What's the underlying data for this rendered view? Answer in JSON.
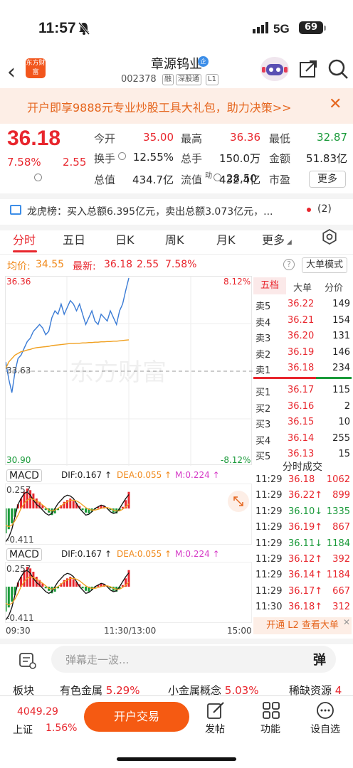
{
  "status_bar": {
    "time": "11:57",
    "network": "5G",
    "battery": "69"
  },
  "header": {
    "logo_text": "东方财富",
    "stock_name": "章源钨业",
    "badge": "企",
    "stock_code": "002378",
    "tags": [
      "融",
      "深股通",
      "L1"
    ]
  },
  "banner": {
    "text": "开户即享9888元专业炒股工具大礼包，助力决策>>"
  },
  "quote": {
    "price": "36.18",
    "change_pct": "7.58%",
    "change": "2.55",
    "rows": [
      [
        {
          "label": "今开",
          "value": "35.00",
          "color": "red"
        },
        {
          "label": "最高",
          "value": "36.36",
          "color": "red"
        },
        {
          "label": "最低",
          "value": "32.87",
          "color": "green"
        }
      ],
      [
        {
          "label": "换手",
          "value": "12.55%",
          "color": "black"
        },
        {
          "label": "总手",
          "value": "150.0万",
          "color": "black"
        },
        {
          "label": "金额",
          "value": "51.83亿",
          "color": "black"
        }
      ],
      [
        {
          "label": "总值",
          "value": "434.7亿",
          "color": "black"
        },
        {
          "label": "流值",
          "value": "432.4亿",
          "color": "black"
        },
        {
          "label": "市盈",
          "value": "28.50",
          "color": "black"
        }
      ]
    ],
    "pe_sup": "动",
    "more_label": "更多"
  },
  "longhu": {
    "text": "龙虎榜：买入总额6.395亿元，卖出总额3.073亿元，...",
    "count": "(2)"
  },
  "tabs": [
    "分时",
    "五日",
    "日K",
    "周K",
    "月K",
    "更多"
  ],
  "chart_header": {
    "avg_label": "均价:",
    "avg_value": "34.55",
    "latest_label": "最新:",
    "latest_value": "36.18",
    "latest_change": "2.55",
    "latest_pct": "7.58%",
    "help": "?",
    "big_order_mode": "大单模式"
  },
  "chart_data": {
    "type": "line",
    "x_labels": [
      "09:30",
      "11:30/13:00",
      "15:00"
    ],
    "ylim": [
      30.9,
      36.36
    ],
    "y_left_ticks": [
      "36.36",
      "33.63",
      "30.90"
    ],
    "y_right_ticks": [
      "8.12%",
      "-8.12%"
    ],
    "prev_close": 33.63,
    "watermark": "东方财富",
    "series": [
      {
        "values": [
          33.9,
          33.4,
          33.0,
          33.6,
          34.0,
          34.1,
          34.3,
          34.5,
          34.6,
          34.8,
          34.9,
          35.0,
          34.9,
          34.7,
          34.8,
          35.2,
          35.4,
          35.3,
          35.6,
          35.3,
          35.5,
          35.7,
          35.6,
          35.4,
          35.6,
          35.3,
          35.0,
          35.2,
          35.4,
          35.1,
          35.0,
          35.3,
          35.2,
          35.1,
          35.4,
          35.2,
          35.0,
          35.4,
          35.6,
          36.0,
          36.36
        ]
      },
      {
        "values": [
          33.7,
          33.9,
          34.0,
          34.1,
          34.15,
          34.2,
          34.22,
          34.25,
          34.27,
          34.3,
          34.32,
          34.33,
          34.34,
          34.35,
          34.36,
          34.38,
          34.39,
          34.4,
          34.41,
          34.42,
          34.43,
          34.44,
          34.44,
          34.45,
          34.45,
          34.46,
          34.46,
          34.47,
          34.47,
          34.48,
          34.48,
          34.49,
          34.49,
          34.5,
          34.5,
          34.51,
          34.51,
          34.52,
          34.53,
          34.54,
          34.55
        ]
      }
    ]
  },
  "orderbook": {
    "tabs": [
      "五档",
      "大单",
      "分价"
    ],
    "asks": [
      {
        "label": "卖5",
        "price": "36.22",
        "vol": "149"
      },
      {
        "label": "卖4",
        "price": "36.21",
        "vol": "154"
      },
      {
        "label": "卖3",
        "price": "36.20",
        "vol": "131"
      },
      {
        "label": "卖2",
        "price": "36.19",
        "vol": "146"
      },
      {
        "label": "卖1",
        "price": "36.18",
        "vol": "234"
      }
    ],
    "bids": [
      {
        "label": "买1",
        "price": "36.17",
        "vol": "115"
      },
      {
        "label": "买2",
        "price": "36.16",
        "vol": "2"
      },
      {
        "label": "买3",
        "price": "36.15",
        "vol": "10"
      },
      {
        "label": "买4",
        "price": "36.14",
        "vol": "255"
      },
      {
        "label": "买5",
        "price": "36.13",
        "vol": "15"
      }
    ]
  },
  "ticks": {
    "title": "分时成交",
    "rows": [
      {
        "time": "11:29",
        "price": "36.18",
        "arrow": "",
        "vol": "1062",
        "dir": "up"
      },
      {
        "time": "11:29",
        "price": "36.22",
        "arrow": "↑",
        "vol": "899",
        "dir": "up"
      },
      {
        "time": "11:29",
        "price": "36.10",
        "arrow": "↓",
        "vol": "1335",
        "dir": "down"
      },
      {
        "time": "11:29",
        "price": "36.19",
        "arrow": "↑",
        "vol": "867",
        "dir": "up"
      },
      {
        "time": "11:29",
        "price": "36.11",
        "arrow": "↓",
        "vol": "1184",
        "dir": "down"
      },
      {
        "time": "11:29",
        "price": "36.12",
        "arrow": "↑",
        "vol": "392",
        "dir": "up"
      },
      {
        "time": "11:29",
        "price": "36.14",
        "arrow": "↑",
        "vol": "1184",
        "dir": "up"
      },
      {
        "time": "11:29",
        "price": "36.17",
        "arrow": "↑",
        "vol": "667",
        "dir": "up"
      },
      {
        "time": "11:30",
        "price": "36.18",
        "arrow": "↑",
        "vol": "312",
        "dir": "up"
      }
    ],
    "l2_text": "开通 L2 查看大单"
  },
  "macd": {
    "label": "MACD",
    "dif": "DIF:0.167 ↑",
    "dea": "DEA:0.055 ↑",
    "m": "M:0.224 ↑",
    "top_tick": "0.257",
    "bottom_tick": "-0.411",
    "bars": [
      -0.3,
      -0.25,
      -0.18,
      -0.1,
      0.05,
      0.12,
      0.2,
      0.24,
      0.22,
      0.18,
      0.12,
      0.08,
      0.04,
      -0.02,
      -0.05,
      -0.08,
      -0.06,
      -0.02,
      0.04,
      0.08,
      0.1,
      0.12,
      0.09,
      0.06,
      0.03,
      -0.02,
      -0.05,
      -0.06,
      -0.04,
      -0.01,
      0.02,
      0.04,
      0.03,
      0.01,
      -0.02,
      -0.05,
      -0.06,
      -0.03,
      0.02,
      0.1,
      0.2
    ],
    "dif_line": [
      -0.4,
      -0.35,
      -0.25,
      -0.1,
      0.05,
      0.12,
      0.18,
      0.2,
      0.16,
      0.1,
      0.05,
      0.02,
      -0.02,
      -0.06,
      -0.08,
      -0.06,
      0.0,
      0.06,
      0.1,
      0.14,
      0.16,
      0.15,
      0.12,
      0.06,
      0.0,
      -0.04,
      -0.08,
      -0.07,
      -0.04,
      0.0,
      0.02,
      0.04,
      0.03,
      0.0,
      -0.04,
      -0.06,
      -0.05,
      0.0,
      0.06,
      0.12,
      0.167
    ],
    "dea_line": [
      -0.2,
      -0.22,
      -0.2,
      -0.15,
      -0.08,
      0.0,
      0.06,
      0.1,
      0.12,
      0.11,
      0.09,
      0.07,
      0.04,
      0.01,
      -0.02,
      -0.03,
      -0.02,
      0.0,
      0.03,
      0.06,
      0.08,
      0.1,
      0.1,
      0.09,
      0.07,
      0.04,
      0.01,
      -0.01,
      -0.02,
      -0.02,
      -0.01,
      0.0,
      0.01,
      0.01,
      0.0,
      -0.02,
      -0.03,
      -0.03,
      -0.01,
      0.02,
      0.055
    ]
  },
  "comment": {
    "placeholder": "弹幕走一波...",
    "danmu": "弹"
  },
  "sectors": [
    {
      "name": "板块",
      "value": ""
    },
    {
      "name": "有色金属",
      "value": "5.29%"
    },
    {
      "name": "小金属概念",
      "value": "5.03%"
    },
    {
      "name": "稀缺资源",
      "value": "4"
    }
  ],
  "bottom": {
    "index_value": "4049.29",
    "index_name": "上证",
    "index_pct": "1.56%",
    "open_button": "开户交易",
    "actions": [
      "发帖",
      "功能",
      "设自选"
    ]
  }
}
